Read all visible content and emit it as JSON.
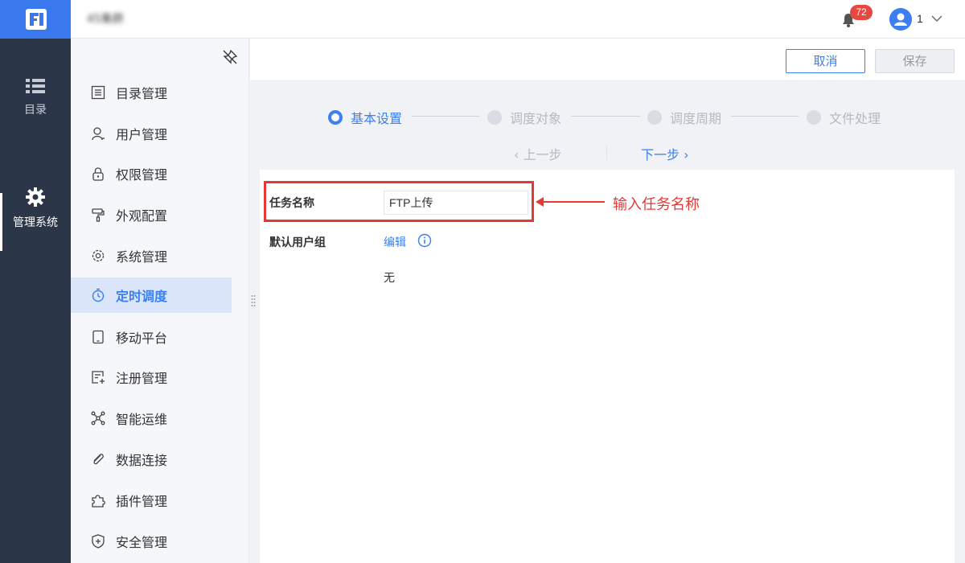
{
  "header": {
    "org_name": "45集群",
    "notification_count": "72",
    "user_name": "1"
  },
  "leftnav": {
    "items": [
      {
        "label": "目录",
        "icon": "list-icon"
      },
      {
        "label": "管理系统",
        "icon": "gear-icon",
        "active": true
      }
    ]
  },
  "sidebar": {
    "items": [
      {
        "label": "目录管理",
        "icon": "catalog-icon"
      },
      {
        "label": "用户管理",
        "icon": "user-icon"
      },
      {
        "label": "权限管理",
        "icon": "lock-icon"
      },
      {
        "label": "外观配置",
        "icon": "paint-roller-icon"
      },
      {
        "label": "系统管理",
        "icon": "settings-icon"
      },
      {
        "label": "定时调度",
        "icon": "stopwatch-icon",
        "active": true
      },
      {
        "label": "移动平台",
        "icon": "tablet-icon"
      },
      {
        "label": "注册管理",
        "icon": "register-icon"
      },
      {
        "label": "智能运维",
        "icon": "network-icon"
      },
      {
        "label": "数据连接",
        "icon": "paperclip-icon"
      },
      {
        "label": "插件管理",
        "icon": "puzzle-icon"
      },
      {
        "label": "安全管理",
        "icon": "shield-icon"
      }
    ]
  },
  "actions": {
    "cancel_label": "取消",
    "save_label": "保存"
  },
  "steps": {
    "items": [
      {
        "label": "基本设置",
        "active": true
      },
      {
        "label": "调度对象",
        "active": false
      },
      {
        "label": "调度周期",
        "active": false
      },
      {
        "label": "文件处理",
        "active": false
      }
    ],
    "prev_label": "上一步",
    "next_label": "下一步"
  },
  "form": {
    "task_name_label": "任务名称",
    "task_name_value": "FTP上传",
    "default_group_label": "默认用户组",
    "edit_label": "编辑",
    "default_group_value": "无"
  },
  "annotation": {
    "text": "输入任务名称"
  },
  "colors": {
    "accent": "#3b7ff0",
    "nav_bg": "#2b3649",
    "annotation_red": "#e53935",
    "badge_red": "#e6473f"
  }
}
